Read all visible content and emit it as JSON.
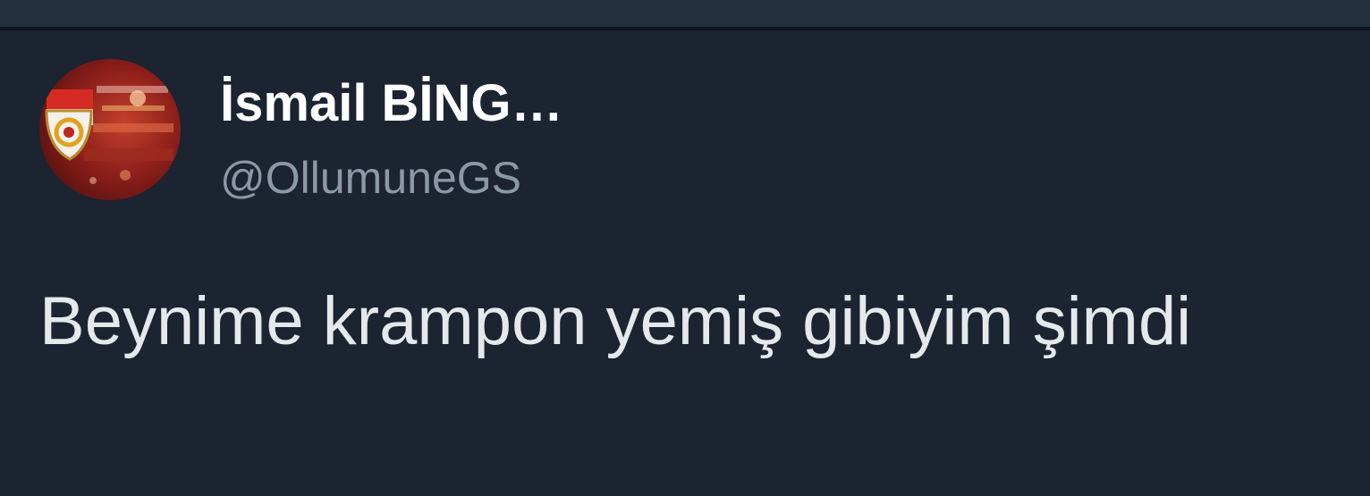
{
  "tweet": {
    "display_name": "İsmail BİNG…",
    "handle": "@OllumuneGS",
    "text": "Beynime krampon yemiş gibiyim şimdi",
    "avatar_icon": "galatasaray-crest-avatar"
  },
  "colors": {
    "background": "#1b2430",
    "name": "#ffffff",
    "handle": "#8b98a5",
    "text": "#e6e9ec"
  }
}
